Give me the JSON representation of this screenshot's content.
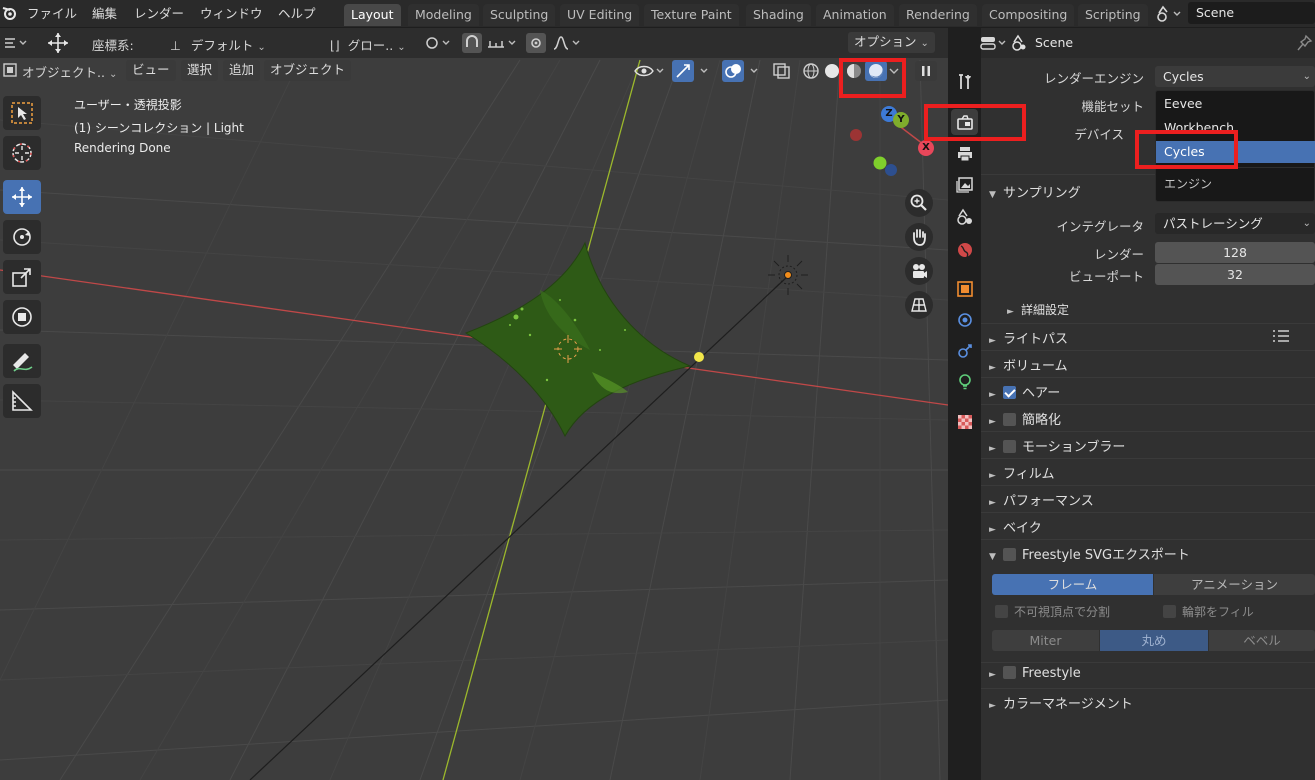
{
  "menu": [
    "ファイル",
    "編集",
    "レンダー",
    "ウィンドウ",
    "ヘルプ"
  ],
  "workspaces": [
    "Layout",
    "Modeling",
    "Sculpting",
    "UV Editing",
    "Texture Paint",
    "Shading",
    "Animation",
    "Rendering",
    "Compositing",
    "Scripting"
  ],
  "scene_name": "Scene",
  "viewport_header": {
    "coord_label": "座標系:",
    "orientation": "デフォルト",
    "pivot": "グロー..",
    "options": "オプション",
    "mode": "オブジェクト..",
    "view": "ビュー",
    "select": "選択",
    "add": "追加",
    "object": "オブジェクト"
  },
  "viewport_overlay": {
    "projection": "ユーザー・透視投影",
    "collection": "(1) シーンコレクション | Light",
    "status": "Rendering Done"
  },
  "gizmo": {
    "x": "X",
    "y": "Y",
    "z": "Z"
  },
  "properties": {
    "header_scene": "Scene",
    "render_engine_label": "レンダーエンジン",
    "render_engine_value": "Cycles",
    "feature_set_label": "機能セット",
    "device_label": "デバイス",
    "engine_menu": {
      "options": [
        "Eevee",
        "Workbench",
        "Cycles"
      ],
      "selected": "Cycles",
      "footer": "エンジン"
    },
    "sampling": {
      "title": "サンプリング",
      "integrator_label": "インテグレータ",
      "integrator_value": "パストレーシング",
      "render_label": "レンダー",
      "render_value": "128",
      "viewport_label": "ビューポート",
      "viewport_value": "32",
      "advanced": "詳細設定"
    },
    "sections": {
      "light_paths": "ライトパス",
      "volumes": "ボリューム",
      "hair": "ヘアー",
      "simplify": "簡略化",
      "motion_blur": "モーションブラー",
      "film": "フィルム",
      "performance": "パフォーマンス",
      "bake": "ベイク",
      "freestyle_svg": "Freestyle SVGエクスポート",
      "freestyle": "Freestyle",
      "color_management": "カラーマネージメント"
    },
    "freestyle_svg": {
      "frame": "フレーム",
      "animation": "アニメーション",
      "split_invisible": "不可視頂点で分割",
      "fill_contour": "輪郭をフィル",
      "miter": "Miter",
      "round": "丸め",
      "bevel": "ベベル"
    }
  },
  "colors": {
    "accent": "#4772b3",
    "annotation": "#ec1f1f",
    "mesh": "#2e5a16"
  }
}
